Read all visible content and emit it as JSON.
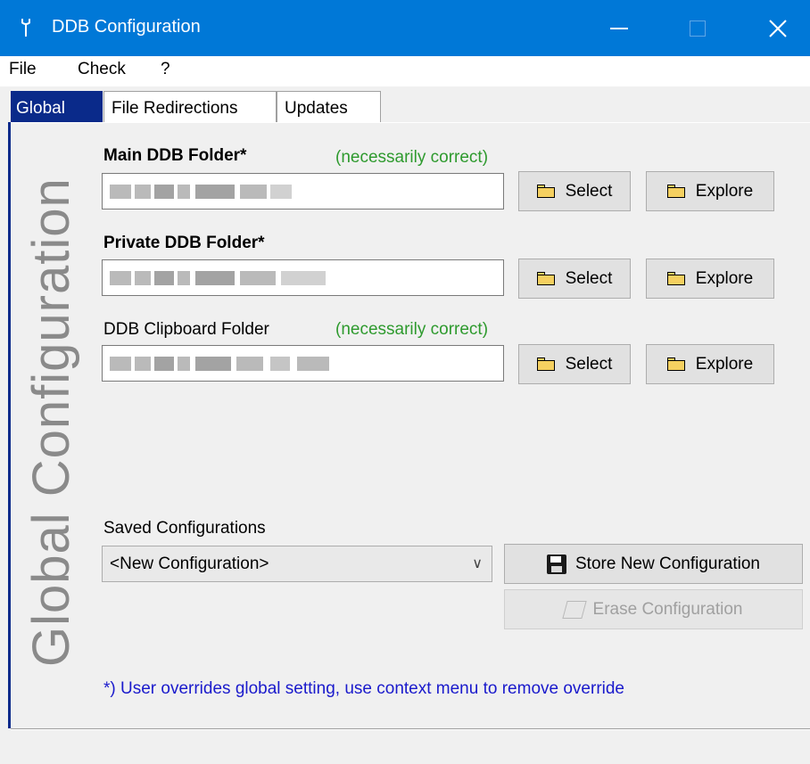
{
  "window": {
    "title": "DDB Configuration",
    "icon": "wrench-icon",
    "accent": "#0078d7"
  },
  "menu": [
    "File",
    "Check",
    "?"
  ],
  "tabs": [
    {
      "label": "Global",
      "active": true
    },
    {
      "label": "File Redirections",
      "active": false
    },
    {
      "label": "Updates",
      "active": false
    }
  ],
  "side_title": "Global Configuration",
  "folders": [
    {
      "label": "Main DDB Folder*",
      "bold": true,
      "hint": "(necessarily correct)"
    },
    {
      "label": "Private DDB Folder*",
      "bold": true,
      "hint": ""
    },
    {
      "label": "DDB Clipboard Folder",
      "bold": false,
      "hint": "(necessarily correct)"
    }
  ],
  "buttons": {
    "select": "Select",
    "explore": "Explore",
    "store": "Store New Configuration",
    "erase": "Erase Configuration"
  },
  "saved": {
    "label": "Saved Configurations",
    "selected": "<New Configuration>"
  },
  "footnote": "*) User overrides global setting, use context menu to remove override",
  "colors": {
    "hint": "#2e9a2e",
    "footnote": "#1a1acc",
    "active_tab": "#0a2a8a"
  }
}
